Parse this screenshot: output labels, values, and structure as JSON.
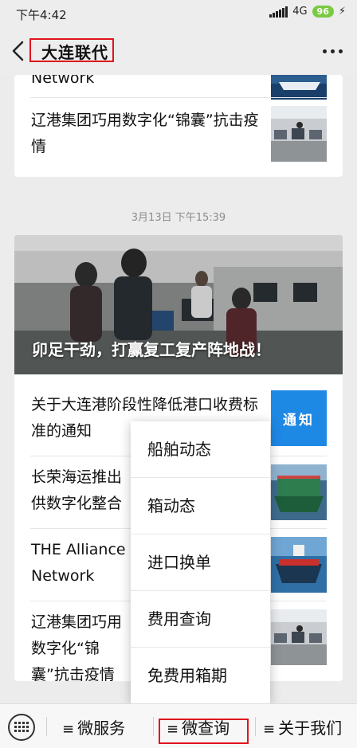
{
  "status": {
    "time": "下午4:42",
    "network": "4G",
    "battery": "96"
  },
  "header": {
    "title": "大连联代"
  },
  "feed": {
    "top_card": {
      "items": [
        {
          "text_visible": "Network"
        },
        {
          "text": "辽港集团巧用数字化“锦囊”抗击疫情"
        }
      ]
    },
    "timestamp": "3月13日 下午15:39",
    "main_card": {
      "hero_caption": "卯足干劲，打赢复工复产阵地战！",
      "items": [
        {
          "text": "关于大连港阶段性降低港口收费标准的通知",
          "thumb_label": "通知"
        },
        {
          "text": "长荣海运推出供数字化整合"
        },
        {
          "text": "THE Alliance Network"
        },
        {
          "text": "辽港集团巧用数字化“锦囊”抗击疫情"
        }
      ]
    }
  },
  "popup_menu": {
    "items": [
      "船舶动态",
      "箱动态",
      "进口换单",
      "费用查询",
      "免费用箱期"
    ]
  },
  "bottom_menu": {
    "items": [
      "微服务",
      "微查询",
      "关于我们"
    ]
  }
}
